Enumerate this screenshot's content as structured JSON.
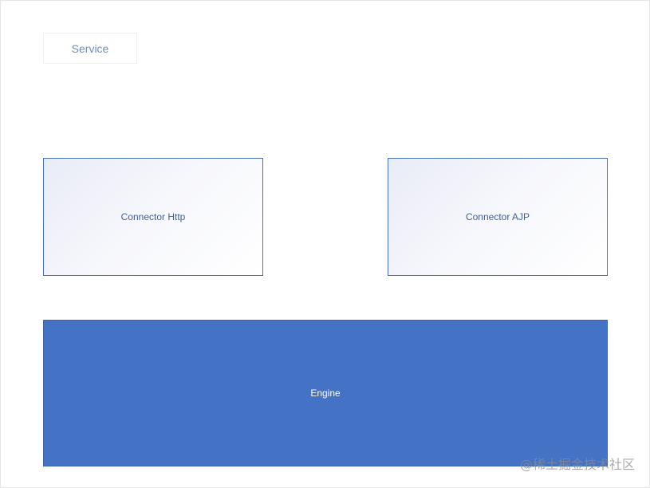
{
  "service": {
    "label": "Service"
  },
  "connectors": [
    {
      "label": "Connector Http"
    },
    {
      "label": "Connector AJP"
    }
  ],
  "engine": {
    "label": "Engine"
  },
  "watermark": {
    "text": "@稀土掘金技术社区"
  },
  "colors": {
    "engine_fill": "#4472c4",
    "connector_border": "#4a73b5",
    "service_text": "#6c8ebf"
  }
}
